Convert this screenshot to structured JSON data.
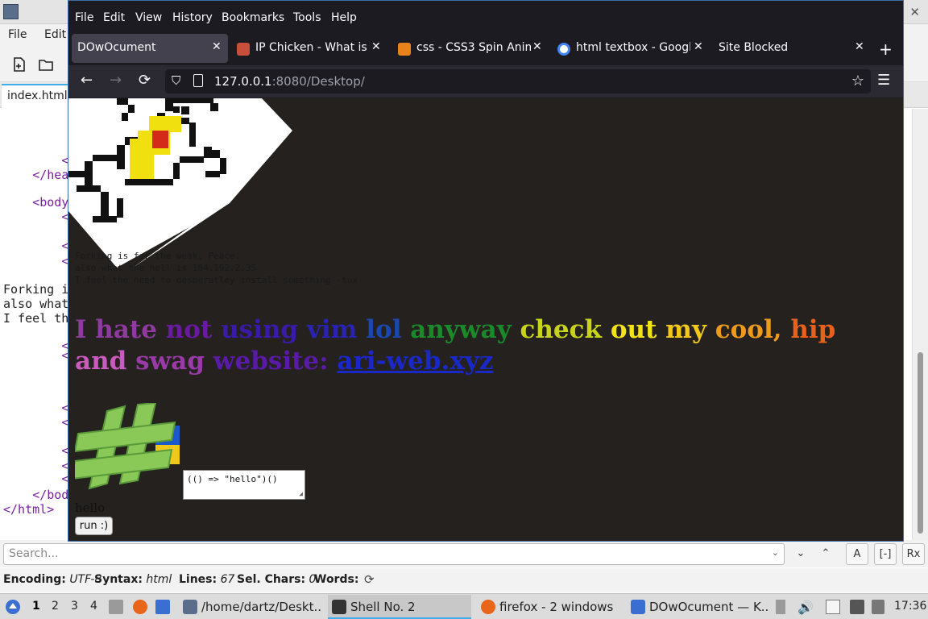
{
  "editor": {
    "menu": [
      "File",
      "Edit"
    ],
    "tab_label": "index.html",
    "code_lines": [
      {
        "indent": "        ",
        "text": "<"
      },
      {
        "indent": "    ",
        "text": "</hea"
      },
      {
        "indent": "",
        "text": ""
      },
      {
        "indent": "    ",
        "text": "<body"
      },
      {
        "indent": "        ",
        "text": "<"
      },
      {
        "indent": "",
        "text": ""
      },
      {
        "indent": "        ",
        "text": "<"
      },
      {
        "indent": "        ",
        "text": "<"
      },
      {
        "indent": "",
        "text": "Forking i"
      },
      {
        "indent": "",
        "text": "also what"
      },
      {
        "indent": "",
        "text": "I feel th"
      },
      {
        "indent": "        ",
        "text": "<"
      },
      {
        "indent": "        ",
        "text": "<"
      },
      {
        "indent": "",
        "text": ""
      },
      {
        "indent": "",
        "text": ""
      },
      {
        "indent": "        ",
        "text": "<"
      },
      {
        "indent": "        ",
        "text": "<"
      },
      {
        "indent": "",
        "text": ""
      },
      {
        "indent": "        ",
        "text": "<"
      },
      {
        "indent": "        ",
        "text": "<"
      },
      {
        "indent": "        ",
        "text": "<"
      },
      {
        "indent": "    ",
        "text": "</bod"
      },
      {
        "indent": "",
        "text": "</html>"
      }
    ],
    "search_placeholder": "Search...",
    "status": {
      "encoding_label": "Encoding:",
      "encoding_value": "UTF-8",
      "syntax_label": "Syntax:",
      "syntax_value": "html",
      "lines_label": "Lines:",
      "lines_value": "67",
      "selchars_label": "Sel. Chars:",
      "selchars_value": "0",
      "words_label": "Words:"
    }
  },
  "firefox": {
    "menu": [
      "File",
      "Edit",
      "View",
      "History",
      "Bookmarks",
      "Tools",
      "Help"
    ],
    "tabs": [
      {
        "title": "DOwOcument",
        "active": true
      },
      {
        "title": "IP Chicken - What is m",
        "active": false
      },
      {
        "title": "css - CSS3 Spin Anim",
        "active": false
      },
      {
        "title": "html textbox - Google",
        "active": false
      },
      {
        "title": "Site Blocked",
        "active": false
      }
    ],
    "url_host": "127.0.0.1",
    "url_rest": ":8080/Desktop/"
  },
  "page": {
    "forking_text": "Forking is for the weak. Peace.\nalso what the hell is 104.192.2.35\nI feel the need to desperatley install something -tux",
    "rainbow_words": [
      {
        "text": "I ",
        "color": "#8e3a9e"
      },
      {
        "text": "hate ",
        "color": "#8e3a9e"
      },
      {
        "text": "not ",
        "color": "#6a1aa0"
      },
      {
        "text": "using ",
        "color": "#3a1aa8"
      },
      {
        "text": "vim ",
        "color": "#2a22b0"
      },
      {
        "text": "lol ",
        "color": "#1a48b0"
      },
      {
        "text": "anyway ",
        "color": "#1a8a2a"
      },
      {
        "text": "check ",
        "color": "#c8d418"
      },
      {
        "text": "out ",
        "color": "#f2e21a"
      },
      {
        "text": "my ",
        "color": "#f2c81a"
      },
      {
        "text": "cool, ",
        "color": "#f09a1a"
      },
      {
        "text": "hip ",
        "color": "#e8601a"
      },
      {
        "text": "and ",
        "color": "#c85ac0"
      },
      {
        "text": "swag ",
        "color": "#9a3aa8"
      },
      {
        "text": "website: ",
        "color": "#5a1aa8"
      }
    ],
    "link_text": "ari-web.xyz",
    "code_box_value": "(() => \"hello\")()",
    "output": "hello",
    "run_label": "run :)"
  },
  "taskbar": {
    "workspaces": [
      "1",
      "2",
      "3",
      "4"
    ],
    "tasks": [
      {
        "label": "/home/dartz/Deskt...",
        "icon_color": "#5a6e8c",
        "active": false
      },
      {
        "label": "Shell No. 2",
        "icon_color": "#333333",
        "active": true
      },
      {
        "label": "firefox - 2 windows",
        "icon_color": "#e8661a",
        "active": false
      },
      {
        "label": "DOwOcument — K...",
        "icon_color": "#3a6ed0",
        "active": false
      }
    ],
    "clock": "17:36"
  },
  "colors": {
    "accent": "#3daee9",
    "firefox_bg": "#1c1b22",
    "page_bg": "#24211f"
  }
}
